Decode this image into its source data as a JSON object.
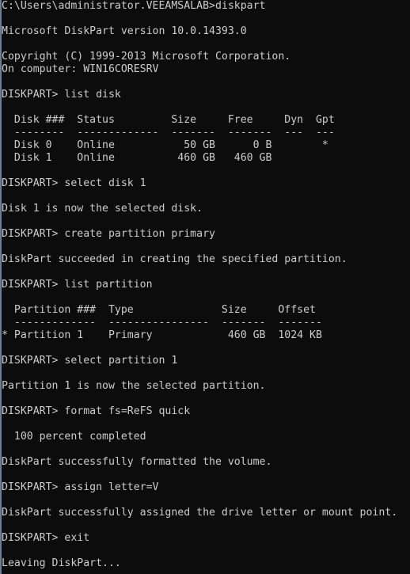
{
  "console": {
    "lines": [
      "C:\\Users\\administrator.VEEAMSALAB>diskpart",
      "",
      "Microsoft DiskPart version 10.0.14393.0",
      "",
      "Copyright (C) 1999-2013 Microsoft Corporation.",
      "On computer: WIN16CORESRV",
      "",
      "DISKPART> list disk",
      "",
      "  Disk ###  Status         Size     Free     Dyn  Gpt",
      "  --------  -------------  -------  -------  ---  ---",
      "  Disk 0    Online           50 GB      0 B        *",
      "  Disk 1    Online          460 GB   460 GB",
      "",
      "DISKPART> select disk 1",
      "",
      "Disk 1 is now the selected disk.",
      "",
      "DISKPART> create partition primary",
      "",
      "DiskPart succeeded in creating the specified partition.",
      "",
      "DISKPART> list partition",
      "",
      "  Partition ###  Type              Size     Offset",
      "  -------------  ----------------  -------  -------",
      "* Partition 1    Primary            460 GB  1024 KB",
      "",
      "DISKPART> select partition 1",
      "",
      "Partition 1 is now the selected partition.",
      "",
      "DISKPART> format fs=ReFS quick",
      "",
      "  100 percent completed",
      "",
      "DiskPart successfully formatted the volume.",
      "",
      "DISKPART> assign letter=V",
      "",
      "DiskPart successfully assigned the drive letter or mount point.",
      "",
      "DISKPART> exit",
      "",
      "Leaving DiskPart..."
    ]
  }
}
